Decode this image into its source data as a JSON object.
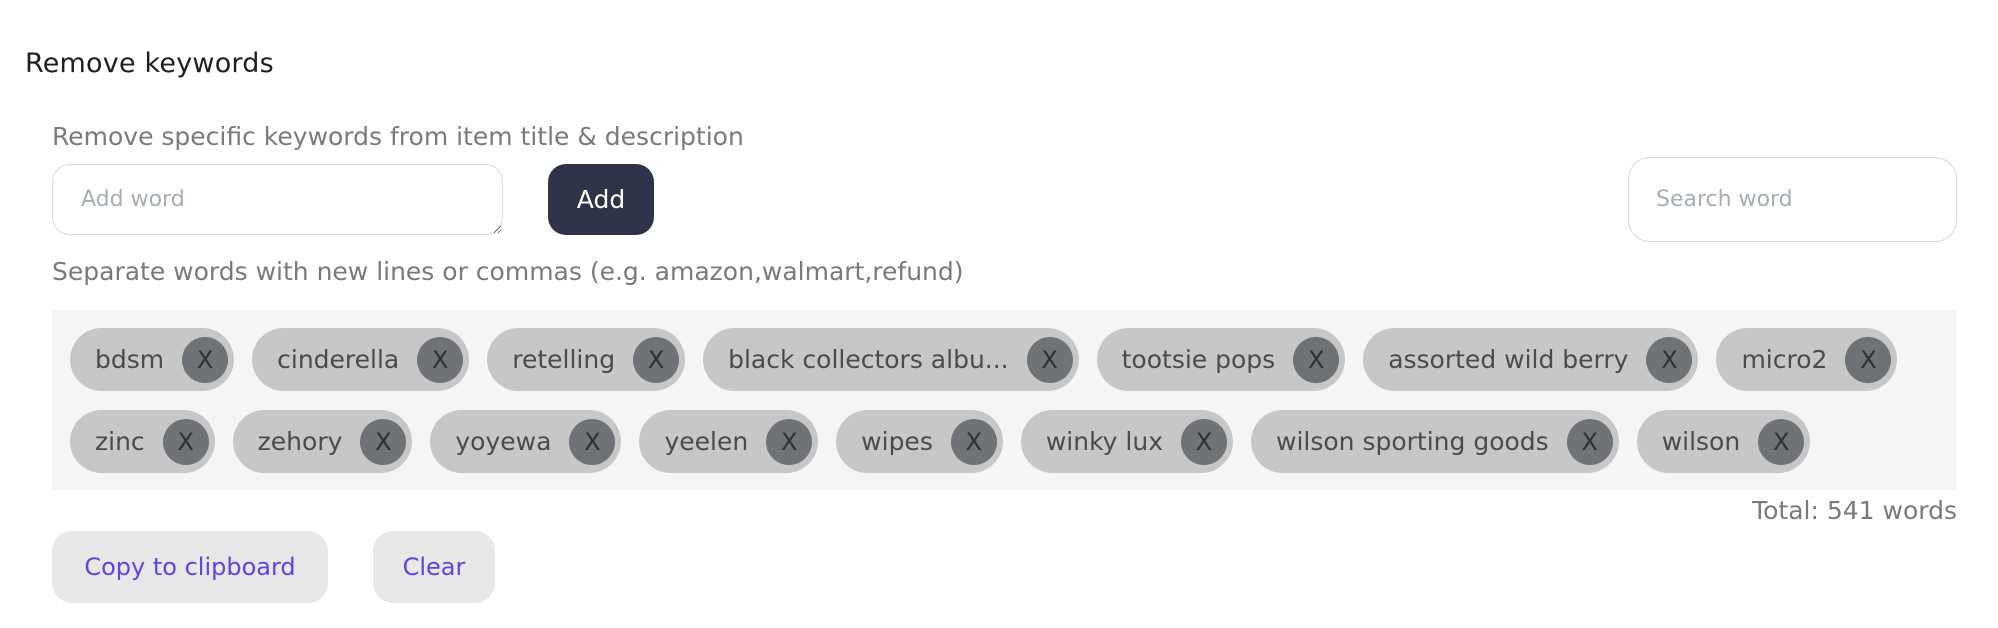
{
  "section": {
    "title": "Remove keywords"
  },
  "add_form": {
    "helper": "Remove specific keywords from item title & description",
    "placeholder": "Add word",
    "button_label": "Add",
    "hint": "Separate words with new lines or commas (e.g. amazon,walmart,refund)"
  },
  "search": {
    "placeholder": "Search word"
  },
  "tags": {
    "remove_label": "X",
    "rows": [
      [
        {
          "label": "bdsm"
        },
        {
          "label": "cinderella"
        },
        {
          "label": "retelling"
        },
        {
          "label": "black collectors albu..."
        },
        {
          "label": "tootsie pops"
        },
        {
          "label": "assorted wild berry"
        },
        {
          "label": "micro2"
        }
      ],
      [
        {
          "label": "zinc"
        },
        {
          "label": "zehory"
        },
        {
          "label": "yoyewa"
        },
        {
          "label": "yeelen"
        },
        {
          "label": "wipes"
        },
        {
          "label": "winky lux"
        },
        {
          "label": "wilson sporting goods"
        },
        {
          "label": "wilson"
        }
      ]
    ]
  },
  "total": "Total: 541 words",
  "actions": {
    "copy_label": "Copy to clipboard",
    "clear_label": "Clear"
  },
  "colors": {
    "primary_button": "#2e3349",
    "link_accent": "#5b46e0",
    "tag_bg": "#c7c7c7",
    "tag_remove_bg": "#6f7277"
  }
}
